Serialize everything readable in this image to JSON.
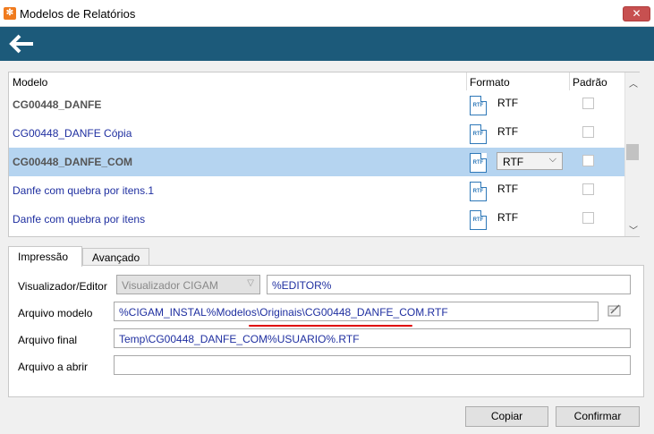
{
  "window": {
    "title": "Modelos de Relatórios",
    "close_label": "✕"
  },
  "toolbar": {
    "back_icon": "back-arrow-icon"
  },
  "grid": {
    "columns": [
      "Modelo",
      "Formato",
      "Padrão"
    ],
    "rows": [
      {
        "modelo": "CG00448_DANFE",
        "formato": "RTF",
        "bold": true,
        "selected": false,
        "padrao": false
      },
      {
        "modelo": "CG00448_DANFE Cópia",
        "formato": "RTF",
        "bold": false,
        "selected": false,
        "padrao": false
      },
      {
        "modelo": "CG00448_DANFE_COM",
        "formato": "RTF",
        "bold": true,
        "selected": true,
        "padrao": false
      },
      {
        "modelo": "Danfe com quebra por itens.1",
        "formato": "RTF",
        "bold": false,
        "selected": false,
        "padrao": false
      },
      {
        "modelo": "Danfe com quebra por itens",
        "formato": "RTF",
        "bold": false,
        "selected": false,
        "padrao": false
      }
    ],
    "icon_label": "RTF"
  },
  "tabs": {
    "impressao": "Impressão",
    "avancado": "Avançado"
  },
  "form": {
    "visualizador_label": "Visualizador/Editor",
    "visualizador_value": "Visualizador CIGAM",
    "editor_value": "%EDITOR%",
    "arquivo_modelo_label": "Arquivo modelo",
    "arquivo_modelo_value": "%CIGAM_INSTAL%Modelos\\Originais\\CG00448_DANFE_COM.RTF",
    "arquivo_final_label": "Arquivo final",
    "arquivo_final_value": "Temp\\CG00448_DANFE_COM%USUARIO%.RTF",
    "arquivo_abrir_label": "Arquivo a abrir",
    "arquivo_abrir_value": ""
  },
  "buttons": {
    "copiar": "Copiar",
    "confirmar": "Confirmar"
  },
  "colors": {
    "toolbar": "#1c5a7a",
    "selected_row": "#b5d4f0",
    "link_text": "#1f2fa0",
    "annotation": "#e00000"
  }
}
